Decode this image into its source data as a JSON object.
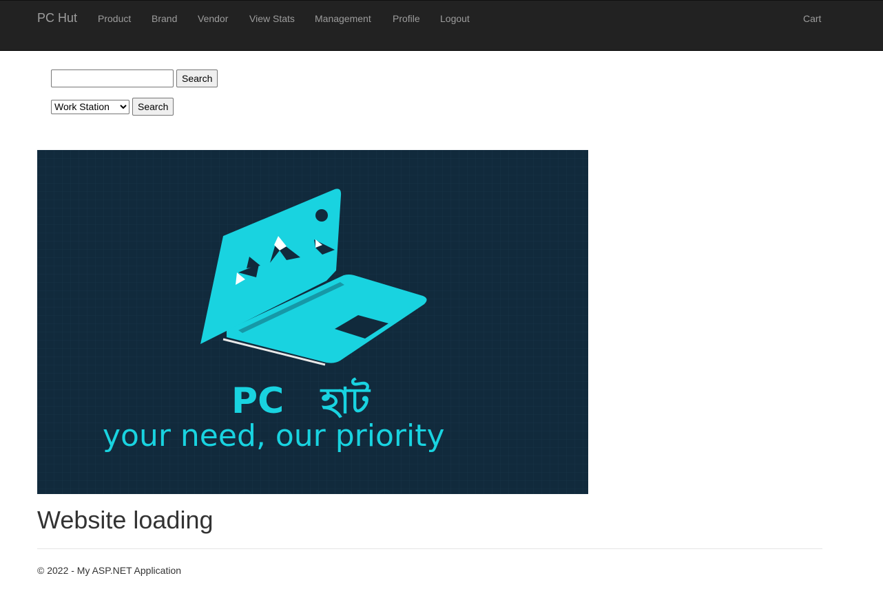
{
  "navbar": {
    "brand": "PC Hut",
    "links": [
      "Product",
      "Brand",
      "Vendor",
      "View Stats",
      "Management",
      "Profile",
      "Logout"
    ],
    "cart": "Cart"
  },
  "search": {
    "text_value": "",
    "search_button": "Search",
    "category_selected": "Work Station",
    "category_button": "Search"
  },
  "banner": {
    "logo_title_latin": "PC",
    "logo_title_bengali": "হাট",
    "tagline": "your need, our priority"
  },
  "main": {
    "heading": "Website loading"
  },
  "footer": {
    "text": "© 2022 - My ASP.NET Application"
  },
  "colors": {
    "navbar_bg": "#222222",
    "banner_bg": "#112a3c",
    "logo_cyan": "#19d3e0"
  }
}
